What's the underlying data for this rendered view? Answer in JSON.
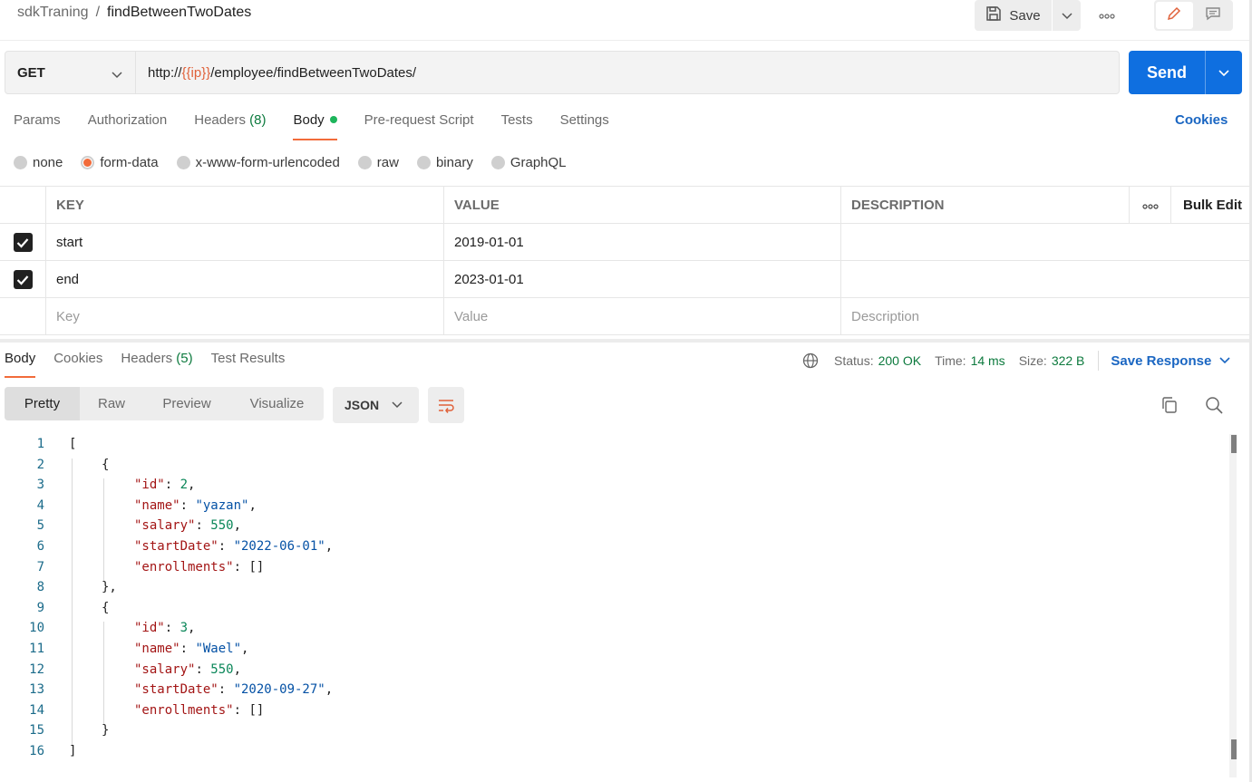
{
  "breadcrumb": {
    "collection": "sdkTraning",
    "separator": "/",
    "request": "findBetweenTwoDates"
  },
  "toolbar": {
    "save_label": "Save"
  },
  "request": {
    "method": "GET",
    "url_prefix": "http://",
    "url_var": "{{ip}}",
    "url_suffix": "/employee/findBetweenTwoDates/",
    "send_label": "Send"
  },
  "req_tabs": {
    "params": "Params",
    "authorization": "Authorization",
    "headers": "Headers",
    "headers_count": "(8)",
    "body": "Body",
    "prerequest": "Pre-request Script",
    "tests": "Tests",
    "settings": "Settings",
    "cookies": "Cookies"
  },
  "body_types": {
    "none": "none",
    "form_data": "form-data",
    "urlencoded": "x-www-form-urlencoded",
    "raw": "raw",
    "binary": "binary",
    "graphql": "GraphQL",
    "selected": "form-data"
  },
  "params_table": {
    "headers": {
      "key": "KEY",
      "value": "VALUE",
      "description": "DESCRIPTION",
      "bulk_edit": "Bulk Edit"
    },
    "rows": [
      {
        "key": "start",
        "value": "2019-01-01",
        "description": "",
        "checked": true
      },
      {
        "key": "end",
        "value": "2023-01-01",
        "description": "",
        "checked": true
      }
    ],
    "placeholders": {
      "key": "Key",
      "value": "Value",
      "description": "Description"
    }
  },
  "response": {
    "tabs": {
      "body": "Body",
      "cookies": "Cookies",
      "headers": "Headers",
      "headers_count": "(5)",
      "test_results": "Test Results"
    },
    "status_label": "Status:",
    "status_value": "200 OK",
    "time_label": "Time:",
    "time_value": "14 ms",
    "size_label": "Size:",
    "size_value": "322 B",
    "save_response": "Save Response",
    "views": {
      "pretty": "Pretty",
      "raw": "Raw",
      "preview": "Preview",
      "visualize": "Visualize"
    },
    "format": "JSON"
  },
  "code_lines": [
    {
      "n": "1",
      "t": "["
    },
    {
      "n": "2",
      "t": "{"
    },
    {
      "n": "3",
      "k": "\"id\"",
      "v": "2",
      "vt": "n",
      "c": ","
    },
    {
      "n": "4",
      "k": "\"name\"",
      "v": "\"yazan\"",
      "vt": "s",
      "c": ","
    },
    {
      "n": "5",
      "k": "\"salary\"",
      "v": "550",
      "vt": "n",
      "c": ","
    },
    {
      "n": "6",
      "k": "\"startDate\"",
      "v": "\"2022-06-01\"",
      "vt": "s",
      "c": ","
    },
    {
      "n": "7",
      "k": "\"enrollments\"",
      "v": "[]",
      "vt": "p",
      "c": ""
    },
    {
      "n": "8",
      "t": "},"
    },
    {
      "n": "9",
      "t": "{"
    },
    {
      "n": "10",
      "k": "\"id\"",
      "v": "3",
      "vt": "n",
      "c": ","
    },
    {
      "n": "11",
      "k": "\"name\"",
      "v": "\"Wael\"",
      "vt": "s",
      "c": ","
    },
    {
      "n": "12",
      "k": "\"salary\"",
      "v": "550",
      "vt": "n",
      "c": ","
    },
    {
      "n": "13",
      "k": "\"startDate\"",
      "v": "\"2020-09-27\"",
      "vt": "s",
      "c": ","
    },
    {
      "n": "14",
      "k": "\"enrollments\"",
      "v": "[]",
      "vt": "p",
      "c": ""
    },
    {
      "n": "15",
      "t": "}"
    },
    {
      "n": "16",
      "t": "]"
    }
  ],
  "colors": {
    "accent": "#f26b3a",
    "send_blue": "#0f6fe0",
    "link_blue": "#1a66c2",
    "status_green": "#0d7a3e"
  },
  "icons": {
    "save": "save-icon",
    "more": "more-horizontal-icon",
    "edit": "pencil-icon",
    "comments": "comment-icon",
    "globe": "globe-icon",
    "wrap": "word-wrap-icon",
    "copy": "copy-icon",
    "search": "search-icon"
  }
}
